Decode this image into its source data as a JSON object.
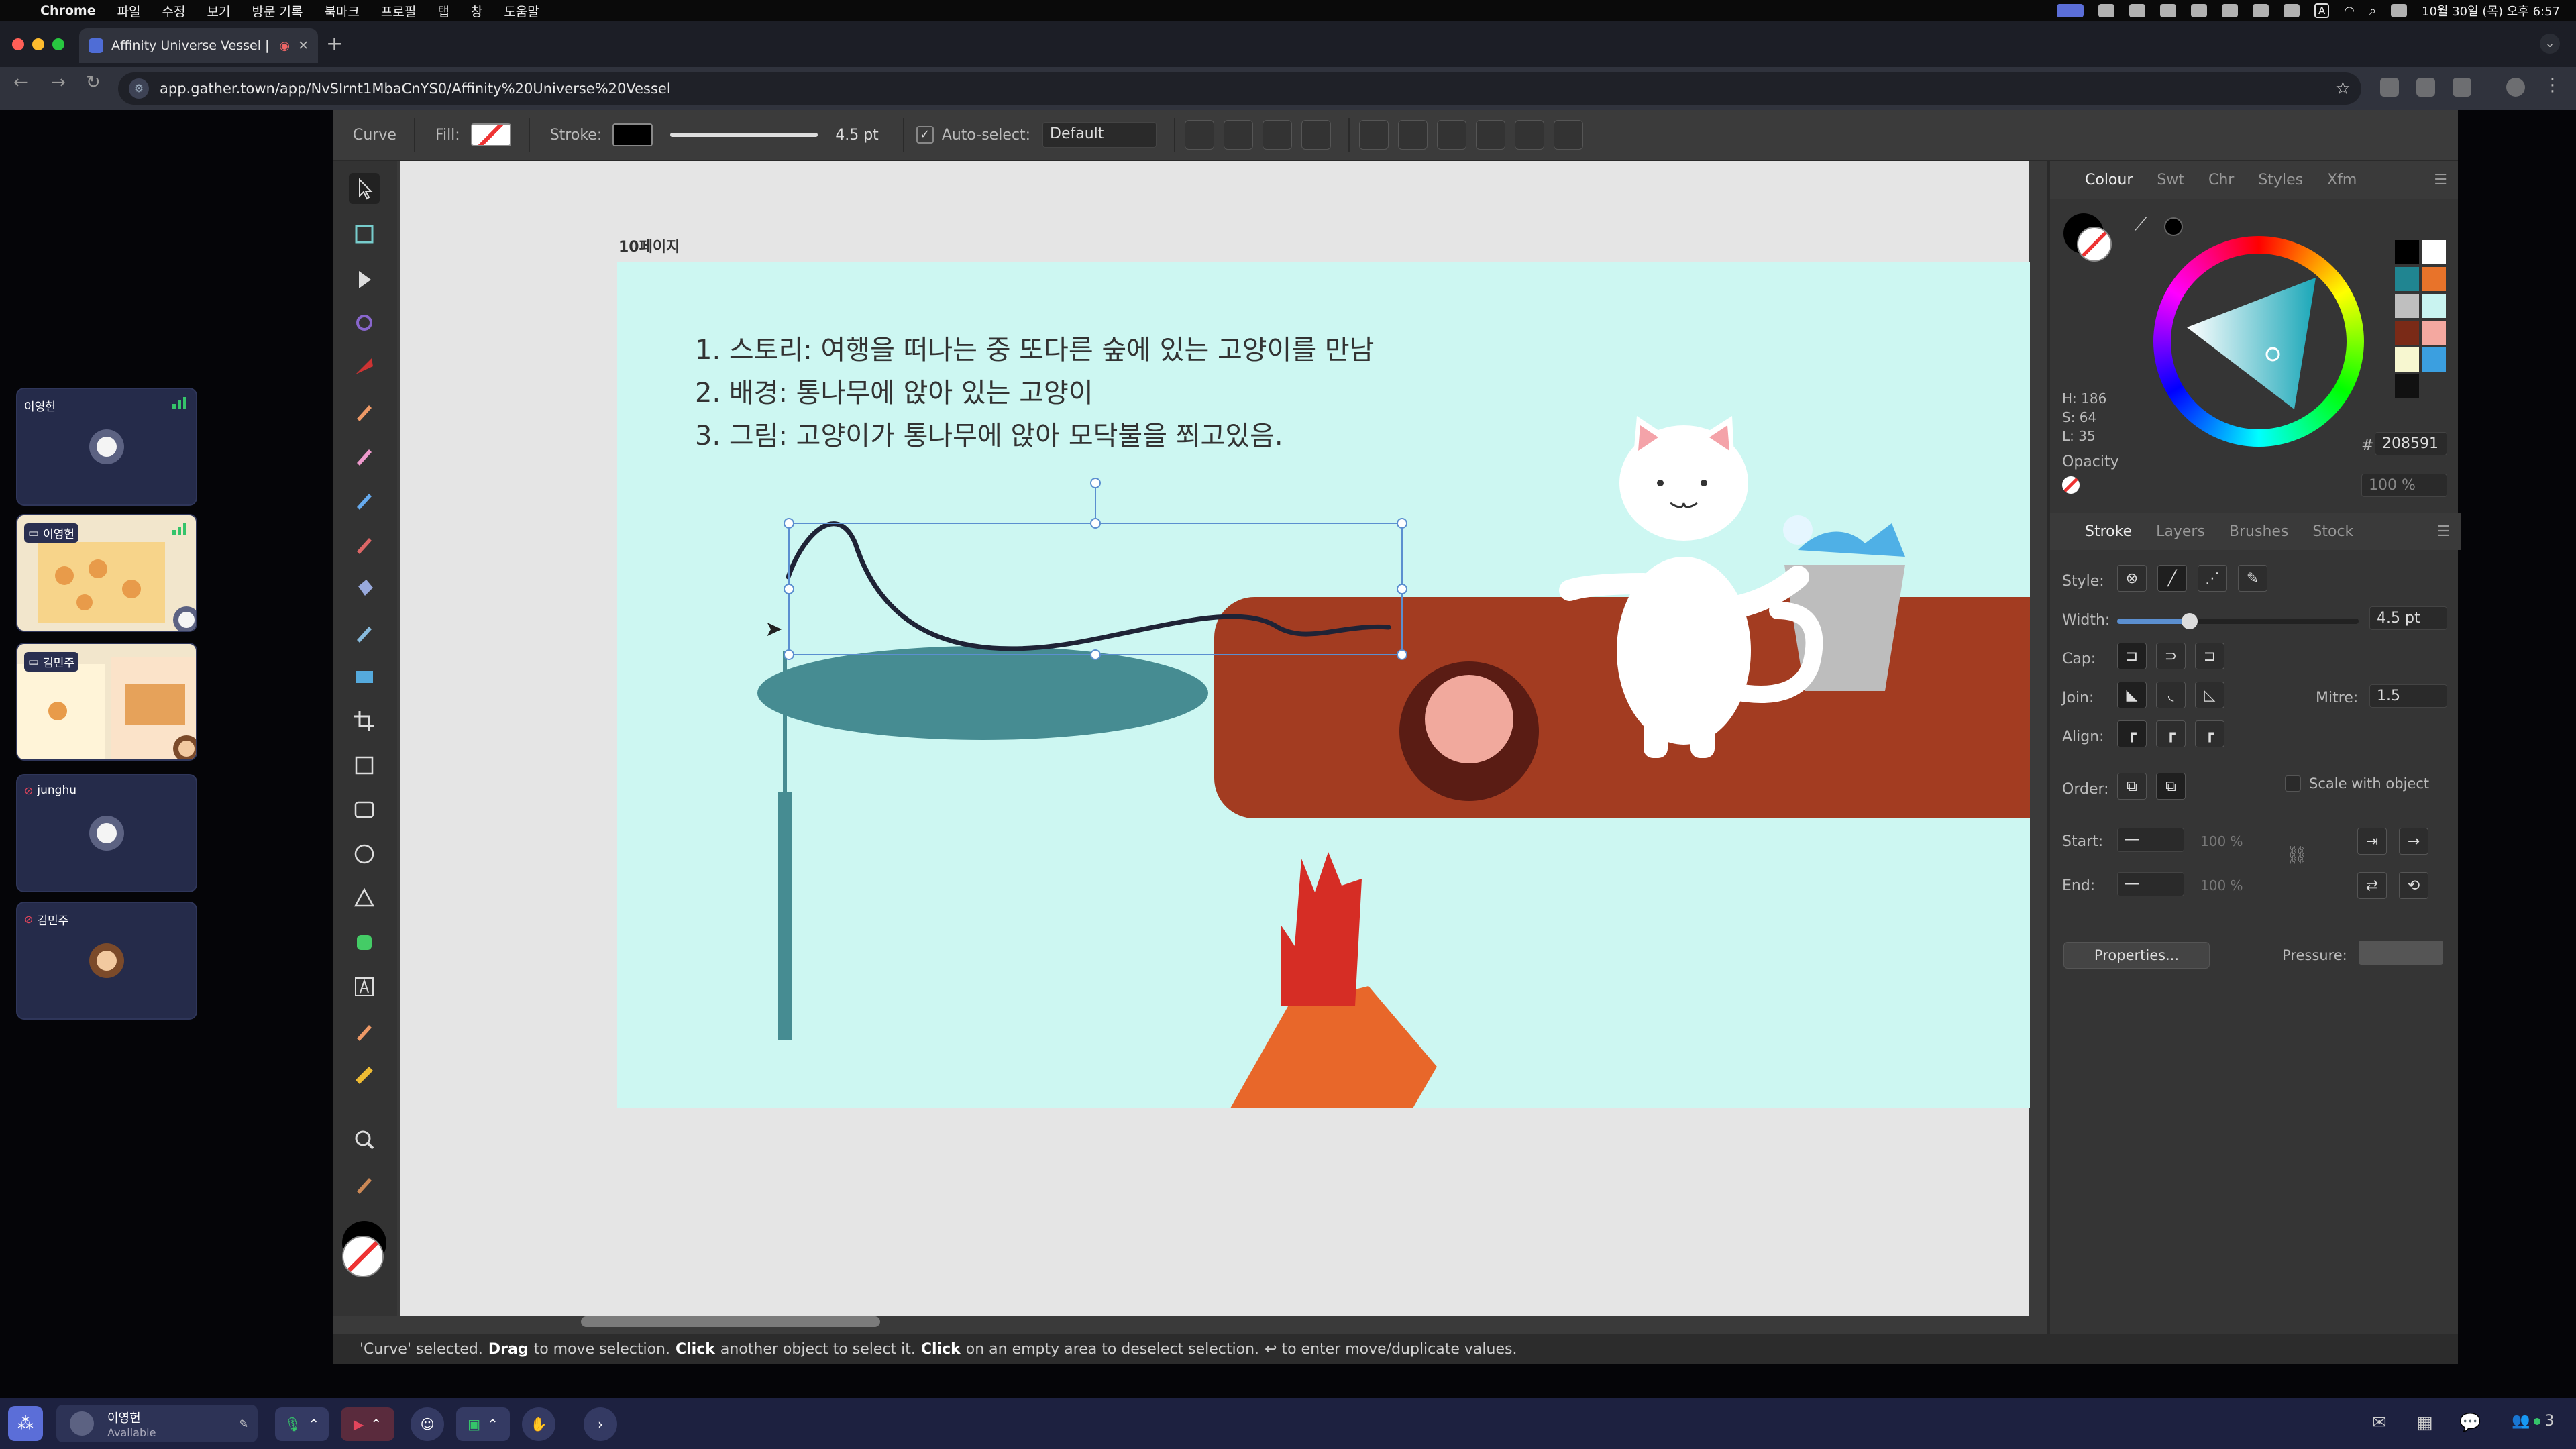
{
  "menubar": {
    "app": "Chrome",
    "items": [
      "파일",
      "수정",
      "보기",
      "방문 기록",
      "북마크",
      "프로필",
      "탭",
      "창",
      "도움말"
    ],
    "clock": "10월 30일 (목) 오후 6:57",
    "input_badge": "A"
  },
  "browser": {
    "tab_title": "Affinity Universe Vessel |",
    "url": "app.gather.town/app/NvSIrnt1MbaCnYS0/Affinity%20Universe%20Vessel"
  },
  "participants": [
    {
      "name": "이영헌",
      "mic_muted": false
    },
    {
      "name": "이영헌",
      "sharing": true
    },
    {
      "name": "김민주",
      "sharing": true
    },
    {
      "name": "junghu",
      "mic_muted": true
    },
    {
      "name": "김민주",
      "mic_muted": true
    }
  ],
  "context_toolbar": {
    "tool": "Curve",
    "fill_label": "Fill:",
    "stroke_label": "Stroke:",
    "stroke_width": "4.5 pt",
    "autoselect_label": "Auto-select:",
    "autoselect_value": "Default"
  },
  "canvas": {
    "artboard_label": "10페이지",
    "story_lines": [
      "1. 스토리: 여행을 떠나는 중 또다른 숲에 있는 고양이를 만남",
      "2. 배경: 통나무에 앉아 있는 고양이",
      "3. 그림: 고양이가 통나무에 앉아 모닥불을 쬐고있음."
    ]
  },
  "colour_panel": {
    "tabs": [
      "Colour",
      "Swt",
      "Chr",
      "Styles",
      "Xfm"
    ],
    "h": "H: 186",
    "s": "S: 64",
    "l": "L: 35",
    "hex_label": "#:",
    "hex": "208591",
    "opacity_label": "Opacity",
    "opacity": "100 %",
    "swatches": [
      "#000000",
      "#ffffff",
      "#208591",
      "#e8732a",
      "#bfbfbf",
      "#c9f3f0",
      "#7a2a17",
      "#f4a8a0",
      "#f7f7d0",
      "#3b9fe0",
      "#111111"
    ]
  },
  "stroke_panel": {
    "tabs": [
      "Stroke",
      "Layers",
      "Brushes",
      "Stock"
    ],
    "style_label": "Style:",
    "width_label": "Width:",
    "width_value": "4.5 pt",
    "width_fraction": 0.3,
    "cap_label": "Cap:",
    "join_label": "Join:",
    "mitre_label": "Mitre:",
    "mitre_value": "1.5",
    "align_label": "Align:",
    "order_label": "Order:",
    "scale_label": "Scale with object",
    "start_label": "Start:",
    "end_label": "End:",
    "start_pct": "100 %",
    "end_pct": "100 %",
    "properties_label": "Properties...",
    "pressure_label": "Pressure:"
  },
  "status": {
    "selected": "'Curve' selected.",
    "drag": "Drag",
    "drag_text": "to move selection.",
    "click1": "Click",
    "click1_text": "another object to select it.",
    "click2": "Click",
    "click2_text": "on an empty area to deselect selection.",
    "enter_text": "↩ to enter move/duplicate values."
  },
  "gather_bar": {
    "name": "이영헌",
    "status": "Available",
    "people_count": "3"
  },
  "colors": {
    "canvas_bg": "#cdf7f2",
    "teal": "#468c92",
    "log": "#a33c21",
    "flame_red": "#d62d25",
    "flame_orange": "#e8672a",
    "selection": "#5b8fd0"
  }
}
